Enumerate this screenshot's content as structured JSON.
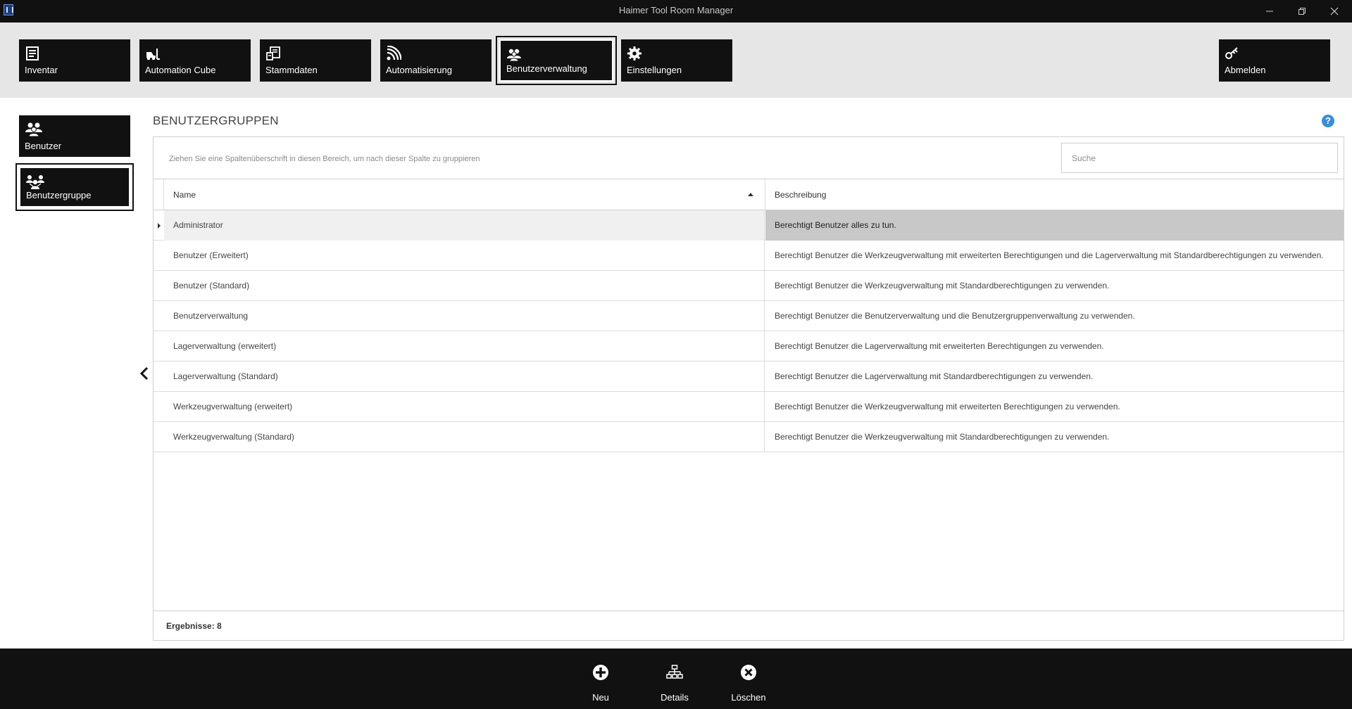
{
  "window": {
    "title": "Haimer Tool Room Manager"
  },
  "nav": {
    "items": [
      {
        "label": "Inventar",
        "icon": "inventory-icon"
      },
      {
        "label": "Automation Cube",
        "icon": "forklift-icon"
      },
      {
        "label": "Stammdaten",
        "icon": "master-data-icon"
      },
      {
        "label": "Automatisierung",
        "icon": "signal-icon"
      },
      {
        "label": "Benutzerverwaltung",
        "icon": "users-icon",
        "active": true
      },
      {
        "label": "Einstellungen",
        "icon": "gear-icon"
      }
    ],
    "logout": "Abmelden"
  },
  "sidebar": {
    "items": [
      {
        "label": "Benutzer",
        "icon": "user-icon"
      },
      {
        "label": "Benutzergruppe",
        "icon": "user-group-icon",
        "active": true
      }
    ]
  },
  "main": {
    "title": "BENUTZERGRUPPEN",
    "group_hint": "Ziehen Sie eine Spaltenüberschrift in diesen Bereich, um nach dieser Spalte zu gruppieren",
    "search_placeholder": "Suche",
    "columns": {
      "name": "Name",
      "description": "Beschreibung"
    },
    "rows": [
      {
        "name": "Administrator",
        "description": "Berechtigt Benutzer alles zu tun."
      },
      {
        "name": "Benutzer (Erweitert)",
        "description": "Berechtigt Benutzer die Werkzeugverwaltung mit erweiterten Berechtigungen und die Lagerverwaltung mit Standardberechtigungen zu verwenden."
      },
      {
        "name": "Benutzer (Standard)",
        "description": "Berechtigt Benutzer die Werkzeugverwaltung mit Standardberechtigungen zu verwenden."
      },
      {
        "name": "Benutzerverwaltung",
        "description": "Berechtigt Benutzer die Benutzerverwaltung und die Benutzergruppenverwaltung zu verwenden."
      },
      {
        "name": "Lagerverwaltung (erweitert)",
        "description": "Berechtigt Benutzer die Lagerverwaltung mit erweiterten Berechtigungen zu verwenden."
      },
      {
        "name": "Lagerverwaltung (Standard)",
        "description": "Berechtigt Benutzer die Lagerverwaltung mit Standardberechtigungen zu verwenden."
      },
      {
        "name": "Werkzeugverwaltung (erweitert)",
        "description": "Berechtigt Benutzer die Werkzeugverwaltung mit erweiterten Berechtigungen zu verwenden."
      },
      {
        "name": "Werkzeugverwaltung (Standard)",
        "description": "Berechtigt Benutzer die Werkzeugverwaltung mit Standardberechtigungen zu verwenden."
      }
    ],
    "results": "Ergebnisse: 8"
  },
  "actions": {
    "new": "Neu",
    "details": "Details",
    "delete": "Löschen"
  },
  "colors": {
    "tile": "#111111",
    "ribbon": "#e6e6e6",
    "selected_row": "#c8c8c8",
    "help": "#3a8ed8"
  }
}
